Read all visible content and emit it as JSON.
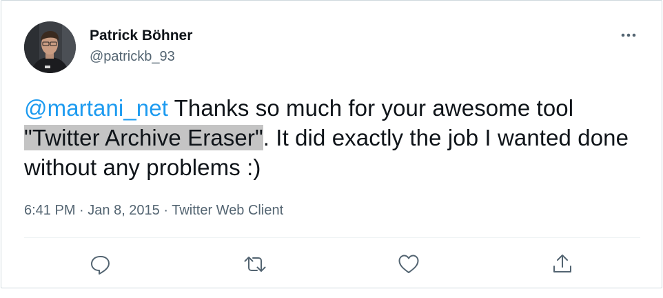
{
  "tweet": {
    "author": {
      "display_name": "Patrick Böhner",
      "handle": "@patrickb_93"
    },
    "text": {
      "mention": "@martani_net",
      "part1": " Thanks so much for your awesome tool",
      "highlighted": "\"Twitter Archive Eraser\"",
      "part2": ". It did exactly the job I wanted done without any problems :)"
    },
    "meta": {
      "time": "6:41 PM",
      "separator1": " · ",
      "date": "Jan 8, 2015",
      "separator2": " · ",
      "client": "Twitter Web Client"
    }
  },
  "actions": {
    "icons": [
      "reply-icon",
      "retweet-icon",
      "like-icon",
      "share-icon"
    ]
  },
  "colors": {
    "text": "#0f1419",
    "muted": "#536471",
    "link": "#1d9bf0",
    "highlight": "#c4c4c4",
    "border": "#cfd9de"
  }
}
